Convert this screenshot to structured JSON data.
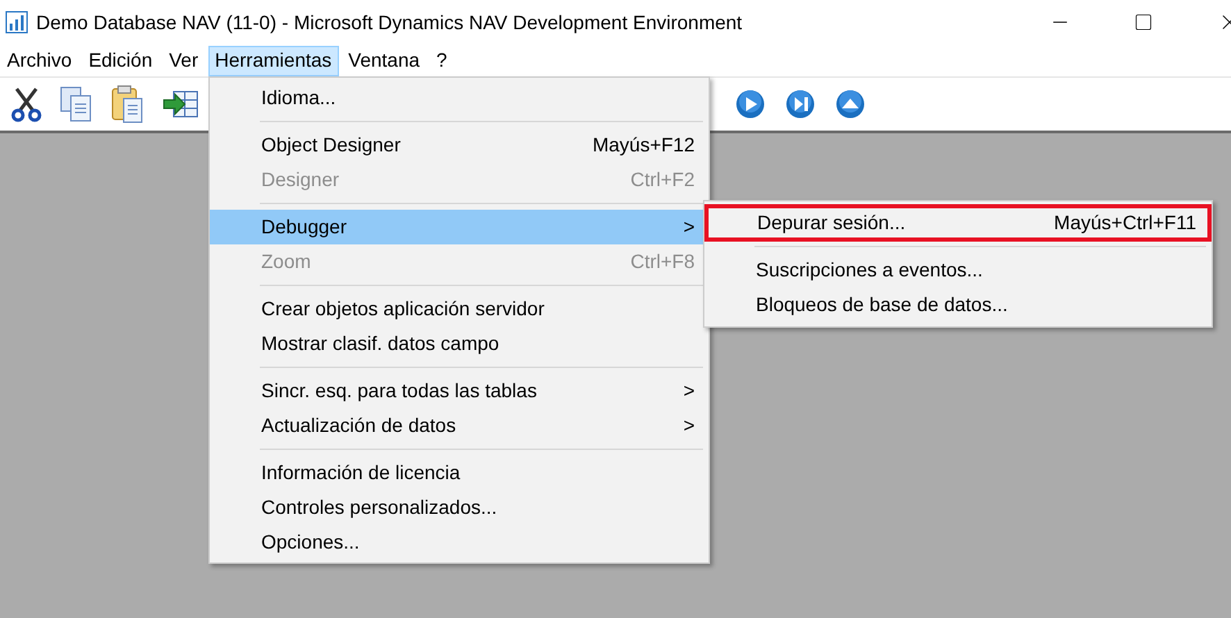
{
  "window": {
    "title": "Demo Database NAV (11-0) - Microsoft Dynamics NAV Development Environment"
  },
  "menu_bar": [
    {
      "label": "Archivo",
      "selected": false
    },
    {
      "label": "Edición",
      "selected": false
    },
    {
      "label": "Ver",
      "selected": false
    },
    {
      "label": "Herramientas",
      "selected": true
    },
    {
      "label": "Ventana",
      "selected": false
    },
    {
      "label": "?",
      "selected": false
    }
  ],
  "dropdown": [
    {
      "kind": "item",
      "label": "Idioma...",
      "disabled": false,
      "selected": false
    },
    {
      "kind": "separator"
    },
    {
      "kind": "item",
      "label": "Object Designer",
      "shortcut": "Mayús+F12",
      "disabled": false,
      "selected": false
    },
    {
      "kind": "item",
      "label": "Designer",
      "shortcut": "Ctrl+F2",
      "disabled": true,
      "selected": false
    },
    {
      "kind": "separator"
    },
    {
      "kind": "item",
      "label": "Debugger",
      "arrow": ">",
      "disabled": false,
      "selected": true
    },
    {
      "kind": "item",
      "label": "Zoom",
      "shortcut": "Ctrl+F8",
      "disabled": true,
      "selected": false
    },
    {
      "kind": "separator"
    },
    {
      "kind": "item",
      "label": "Crear objetos aplicación servidor",
      "disabled": false,
      "selected": false
    },
    {
      "kind": "item",
      "label": "Mostrar clasif. datos campo",
      "disabled": false,
      "selected": false
    },
    {
      "kind": "separator"
    },
    {
      "kind": "item",
      "label": "Sincr. esq. para todas las tablas",
      "arrow": ">",
      "disabled": false,
      "selected": false
    },
    {
      "kind": "item",
      "label": "Actualización de datos",
      "arrow": ">",
      "disabled": false,
      "selected": false
    },
    {
      "kind": "separator"
    },
    {
      "kind": "item",
      "label": "Información de licencia",
      "disabled": false,
      "selected": false
    },
    {
      "kind": "item",
      "label": "Controles personalizados...",
      "disabled": false,
      "selected": false
    },
    {
      "kind": "item",
      "label": "Opciones...",
      "disabled": false,
      "selected": false
    }
  ],
  "submenu": [
    {
      "kind": "item",
      "label": "Depurar sesión...",
      "shortcut": "Mayús+Ctrl+F11",
      "highlighted": true
    },
    {
      "kind": "separator"
    },
    {
      "kind": "item",
      "label": "Suscripciones a eventos...",
      "highlighted": false
    },
    {
      "kind": "item",
      "label": "Bloqueos de base de datos...",
      "highlighted": false
    }
  ]
}
